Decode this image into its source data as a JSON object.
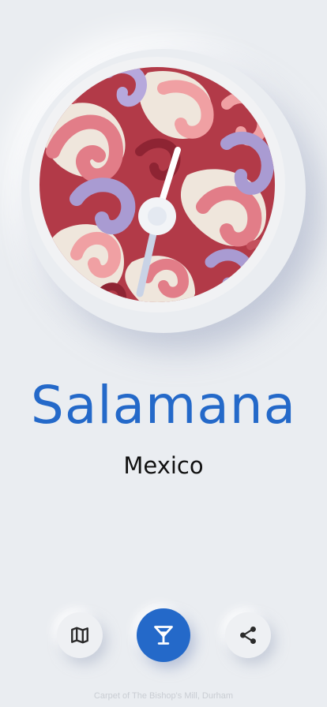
{
  "clock": {
    "artwork": "red and lilac paisley swirl carpet pattern",
    "hour_hand_color": "#c9d3e6",
    "minute_hand_color": "#ffffff"
  },
  "city": {
    "name": "Salamana",
    "country": "Mexico"
  },
  "actions": [
    {
      "name": "map",
      "icon": "map-icon"
    },
    {
      "name": "drinks",
      "icon": "cocktail-icon"
    },
    {
      "name": "share",
      "icon": "share-icon"
    }
  ],
  "credit": "Carpet of The Bishop's Mill, Durham",
  "colors": {
    "accent": "#2469c9",
    "background": "#eaedf1",
    "carpet_red": "#b23a48",
    "carpet_pink": "#e27d88",
    "carpet_lilac": "#a99bd2",
    "carpet_cream": "#efe6dc"
  }
}
